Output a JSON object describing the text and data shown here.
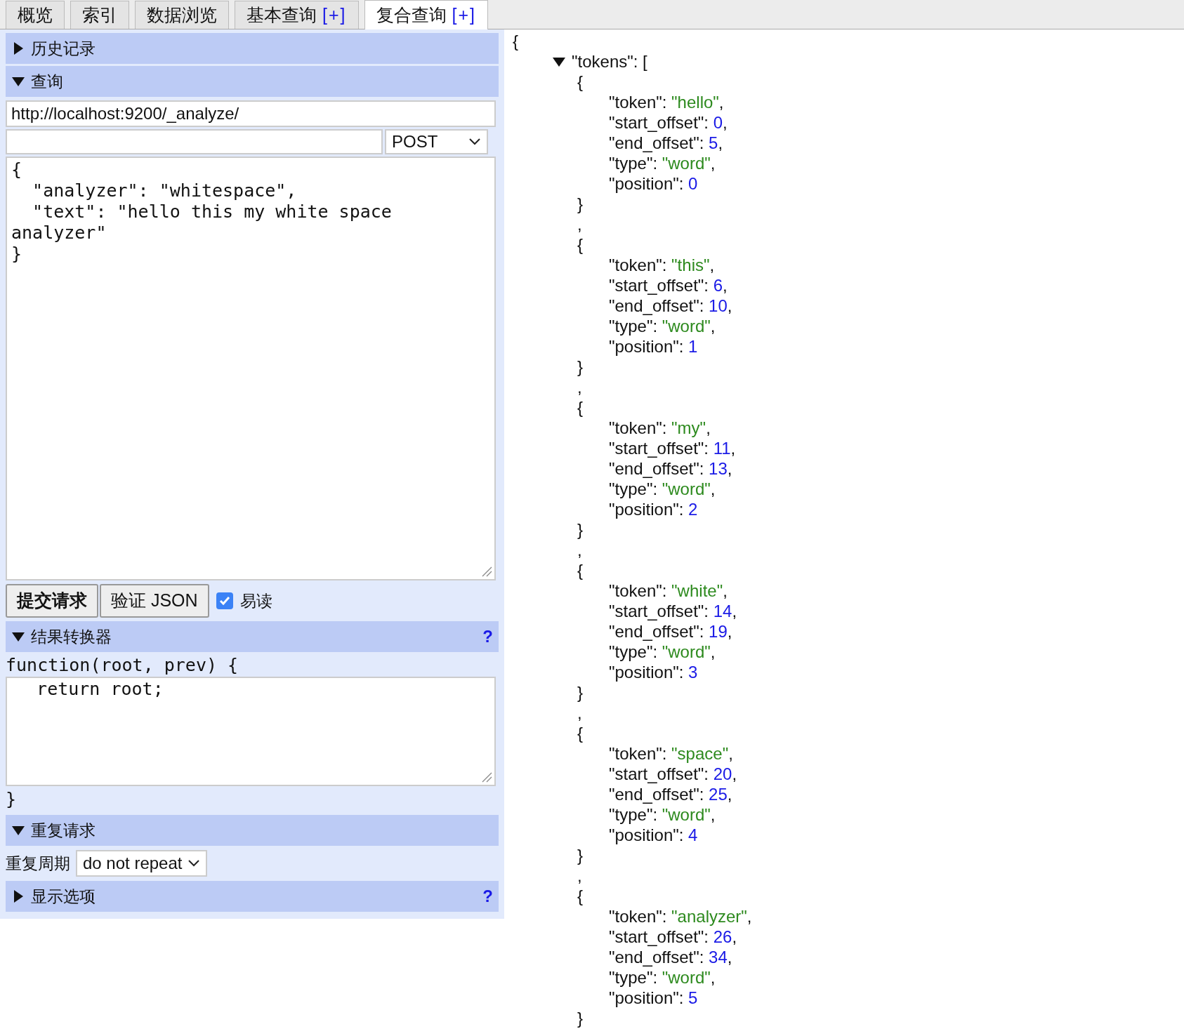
{
  "tabs": [
    {
      "label": "概览",
      "selected": false
    },
    {
      "label": "索引",
      "selected": false
    },
    {
      "label": "数据浏览",
      "selected": false
    },
    {
      "label": "基本查询",
      "action": "[+]",
      "selected": false
    },
    {
      "label": "复合查询",
      "action": "[+]",
      "selected": true
    }
  ],
  "history": {
    "title": "历史记录",
    "expanded": false
  },
  "query": {
    "title": "查询",
    "expanded": true,
    "url": "http://localhost:9200/_analyze/",
    "method": "POST",
    "body": "{\n  \"analyzer\": \"whitespace\",\n  \"text\": \"hello this my white space analyzer\"\n}",
    "submit": "提交请求",
    "validate": "验证 JSON",
    "pretty": {
      "label": "易读",
      "checked": true
    }
  },
  "transformer": {
    "title": "结果转换器",
    "expanded": true,
    "help": "?",
    "header": "function(root, prev) {",
    "code": "  return root;",
    "footer": "}"
  },
  "repeat": {
    "title": "重复请求",
    "expanded": true,
    "label": "重复周期",
    "period": "do not repeat"
  },
  "display": {
    "title": "显示选项",
    "expanded": false,
    "help": "?"
  },
  "result": {
    "open": "{",
    "key": "\"tokens\": [",
    "expanded": true,
    "tokens": [
      {
        "open": "{",
        "close": "}",
        "after": ",",
        "fields": [
          {
            "key": "\"token\": ",
            "value": "\"hello\"",
            "kind": "string",
            "sep": ","
          },
          {
            "key": "\"start_offset\": ",
            "value": "0",
            "kind": "number",
            "sep": ","
          },
          {
            "key": "\"end_offset\": ",
            "value": "5",
            "kind": "number",
            "sep": ","
          },
          {
            "key": "\"type\": ",
            "value": "\"word\"",
            "kind": "string",
            "sep": ","
          },
          {
            "key": "\"position\": ",
            "value": "0",
            "kind": "number"
          }
        ]
      },
      {
        "open": "{",
        "close": "}",
        "after": ",",
        "fields": [
          {
            "key": "\"token\": ",
            "value": "\"this\"",
            "kind": "string",
            "sep": ","
          },
          {
            "key": "\"start_offset\": ",
            "value": "6",
            "kind": "number",
            "sep": ","
          },
          {
            "key": "\"end_offset\": ",
            "value": "10",
            "kind": "number",
            "sep": ","
          },
          {
            "key": "\"type\": ",
            "value": "\"word\"",
            "kind": "string",
            "sep": ","
          },
          {
            "key": "\"position\": ",
            "value": "1",
            "kind": "number"
          }
        ]
      },
      {
        "open": "{",
        "close": "}",
        "after": ",",
        "fields": [
          {
            "key": "\"token\": ",
            "value": "\"my\"",
            "kind": "string",
            "sep": ","
          },
          {
            "key": "\"start_offset\": ",
            "value": "11",
            "kind": "number",
            "sep": ","
          },
          {
            "key": "\"end_offset\": ",
            "value": "13",
            "kind": "number",
            "sep": ","
          },
          {
            "key": "\"type\": ",
            "value": "\"word\"",
            "kind": "string",
            "sep": ","
          },
          {
            "key": "\"position\": ",
            "value": "2",
            "kind": "number"
          }
        ]
      },
      {
        "open": "{",
        "close": "}",
        "after": ",",
        "fields": [
          {
            "key": "\"token\": ",
            "value": "\"white\"",
            "kind": "string",
            "sep": ","
          },
          {
            "key": "\"start_offset\": ",
            "value": "14",
            "kind": "number",
            "sep": ","
          },
          {
            "key": "\"end_offset\": ",
            "value": "19",
            "kind": "number",
            "sep": ","
          },
          {
            "key": "\"type\": ",
            "value": "\"word\"",
            "kind": "string",
            "sep": ","
          },
          {
            "key": "\"position\": ",
            "value": "3",
            "kind": "number"
          }
        ]
      },
      {
        "open": "{",
        "close": "}",
        "after": ",",
        "fields": [
          {
            "key": "\"token\": ",
            "value": "\"space\"",
            "kind": "string",
            "sep": ","
          },
          {
            "key": "\"start_offset\": ",
            "value": "20",
            "kind": "number",
            "sep": ","
          },
          {
            "key": "\"end_offset\": ",
            "value": "25",
            "kind": "number",
            "sep": ","
          },
          {
            "key": "\"type\": ",
            "value": "\"word\"",
            "kind": "string",
            "sep": ","
          },
          {
            "key": "\"position\": ",
            "value": "4",
            "kind": "number"
          }
        ]
      },
      {
        "open": "{",
        "close": "}",
        "fields": [
          {
            "key": "\"token\": ",
            "value": "\"analyzer\"",
            "kind": "string",
            "sep": ","
          },
          {
            "key": "\"start_offset\": ",
            "value": "26",
            "kind": "number",
            "sep": ","
          },
          {
            "key": "\"end_offset\": ",
            "value": "34",
            "kind": "number",
            "sep": ","
          },
          {
            "key": "\"type\": ",
            "value": "\"word\"",
            "kind": "string",
            "sep": ","
          },
          {
            "key": "\"position\": ",
            "value": "5",
            "kind": "number"
          }
        ]
      }
    ]
  }
}
